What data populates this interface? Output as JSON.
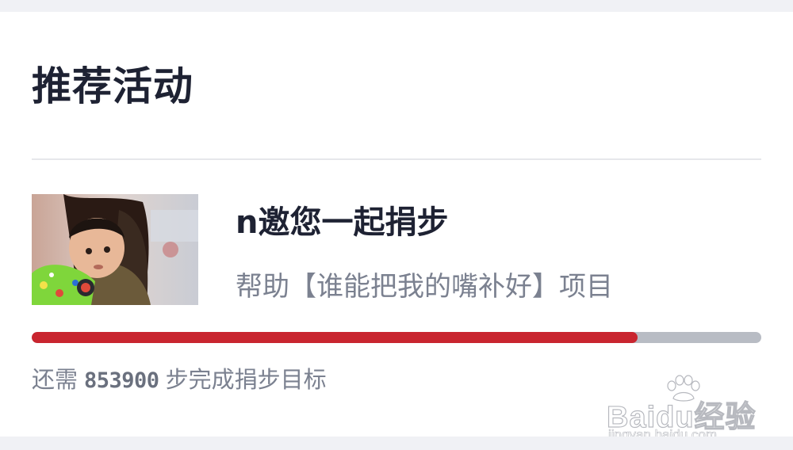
{
  "section": {
    "title": "推荐活动"
  },
  "activity": {
    "title": "n邀您一起捐步",
    "description": "帮助【谁能把我的嘴补好】项目",
    "image_alt": "child-photo",
    "progress_fraction": 0.83,
    "remaining_prefix": "还需",
    "remaining_steps": "853900",
    "remaining_suffix": "步完成捐步目标"
  },
  "watermark": {
    "main": "Baidu经验",
    "sub": "jingyan.baidu.com"
  },
  "colors": {
    "title": "#1e2233",
    "secondary_text": "#7b8190",
    "progress_fill": "#c9252f",
    "progress_track": "#b8bcc4",
    "background": "#f0f1f5",
    "card": "#ffffff"
  }
}
